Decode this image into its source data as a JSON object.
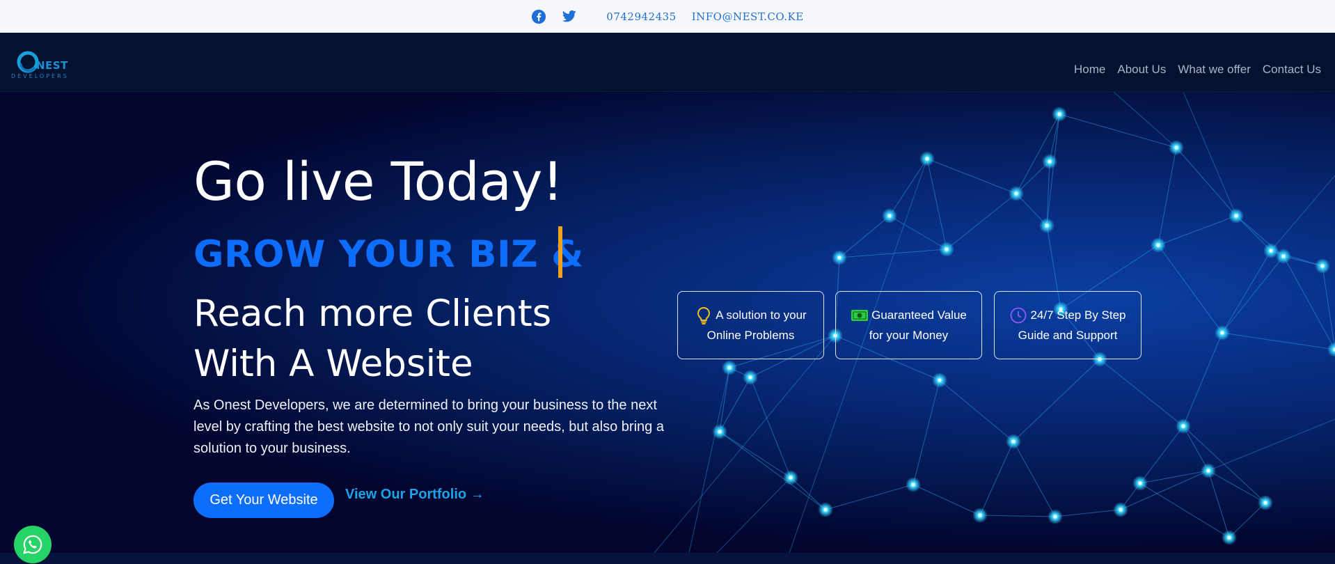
{
  "topbar": {
    "facebook_icon": "facebook-icon",
    "twitter_icon": "twitter-icon",
    "phone": "0742942435",
    "email": "INFO@NEST.CO.KE"
  },
  "navbar": {
    "logo_text": "NEST",
    "logo_subtext": "DEVELOPERS",
    "links": [
      "Home",
      "About Us",
      "What we offer",
      "Contact Us"
    ]
  },
  "hero": {
    "title": "Go live Today!",
    "typed_text": "GROW YOUR BIZ &",
    "subtitle_line1": "Reach more Clients",
    "subtitle_line2": "With A Website",
    "description": "As Onest Developers, we are determined to bring your business to the next level by crafting the best website to not only suit your needs, but also bring a solution to your business.",
    "primary_button": "Get Your Website",
    "secondary_link": "View Our Portfolio →"
  },
  "features": [
    {
      "icon": "lightbulb-icon",
      "line1": "A solution to your",
      "line2": "Online Problems"
    },
    {
      "icon": "cash-icon",
      "line1": "Guaranteed Value",
      "line2": "for your Money"
    },
    {
      "icon": "clock-icon",
      "line1": "24/7 Step By Step",
      "line2": "Guide and Support"
    }
  ],
  "colors": {
    "accent": "#0d6efd",
    "caret": "#f2a21a",
    "whatsapp": "#25d366",
    "link": "#1ea3e6"
  },
  "whatsapp_icon": "whatsapp-icon"
}
